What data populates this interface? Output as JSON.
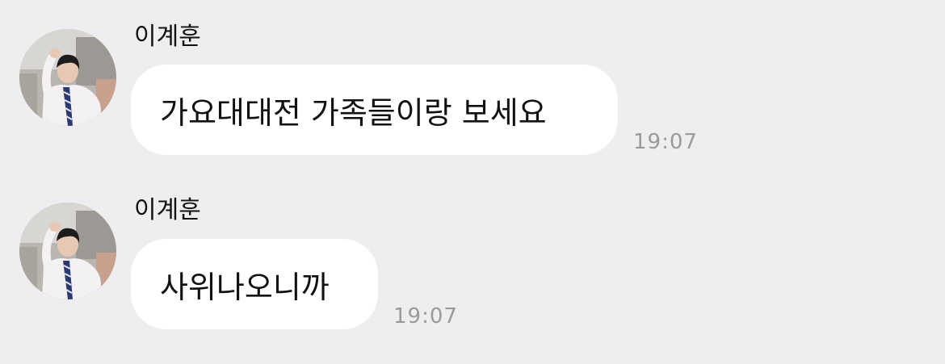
{
  "messages": [
    {
      "sender": "이계훈",
      "text": "가요대대전 가족들이랑 보세요",
      "time": "19:07",
      "avatar_icon": "profile-photo"
    },
    {
      "sender": "이계훈",
      "text": "사위나오니까",
      "time": "19:07",
      "avatar_icon": "profile-photo"
    }
  ],
  "colors": {
    "background": "#eeeef0",
    "bubble": "#ffffff",
    "text": "#111111",
    "timestamp": "#9a9a9a"
  }
}
